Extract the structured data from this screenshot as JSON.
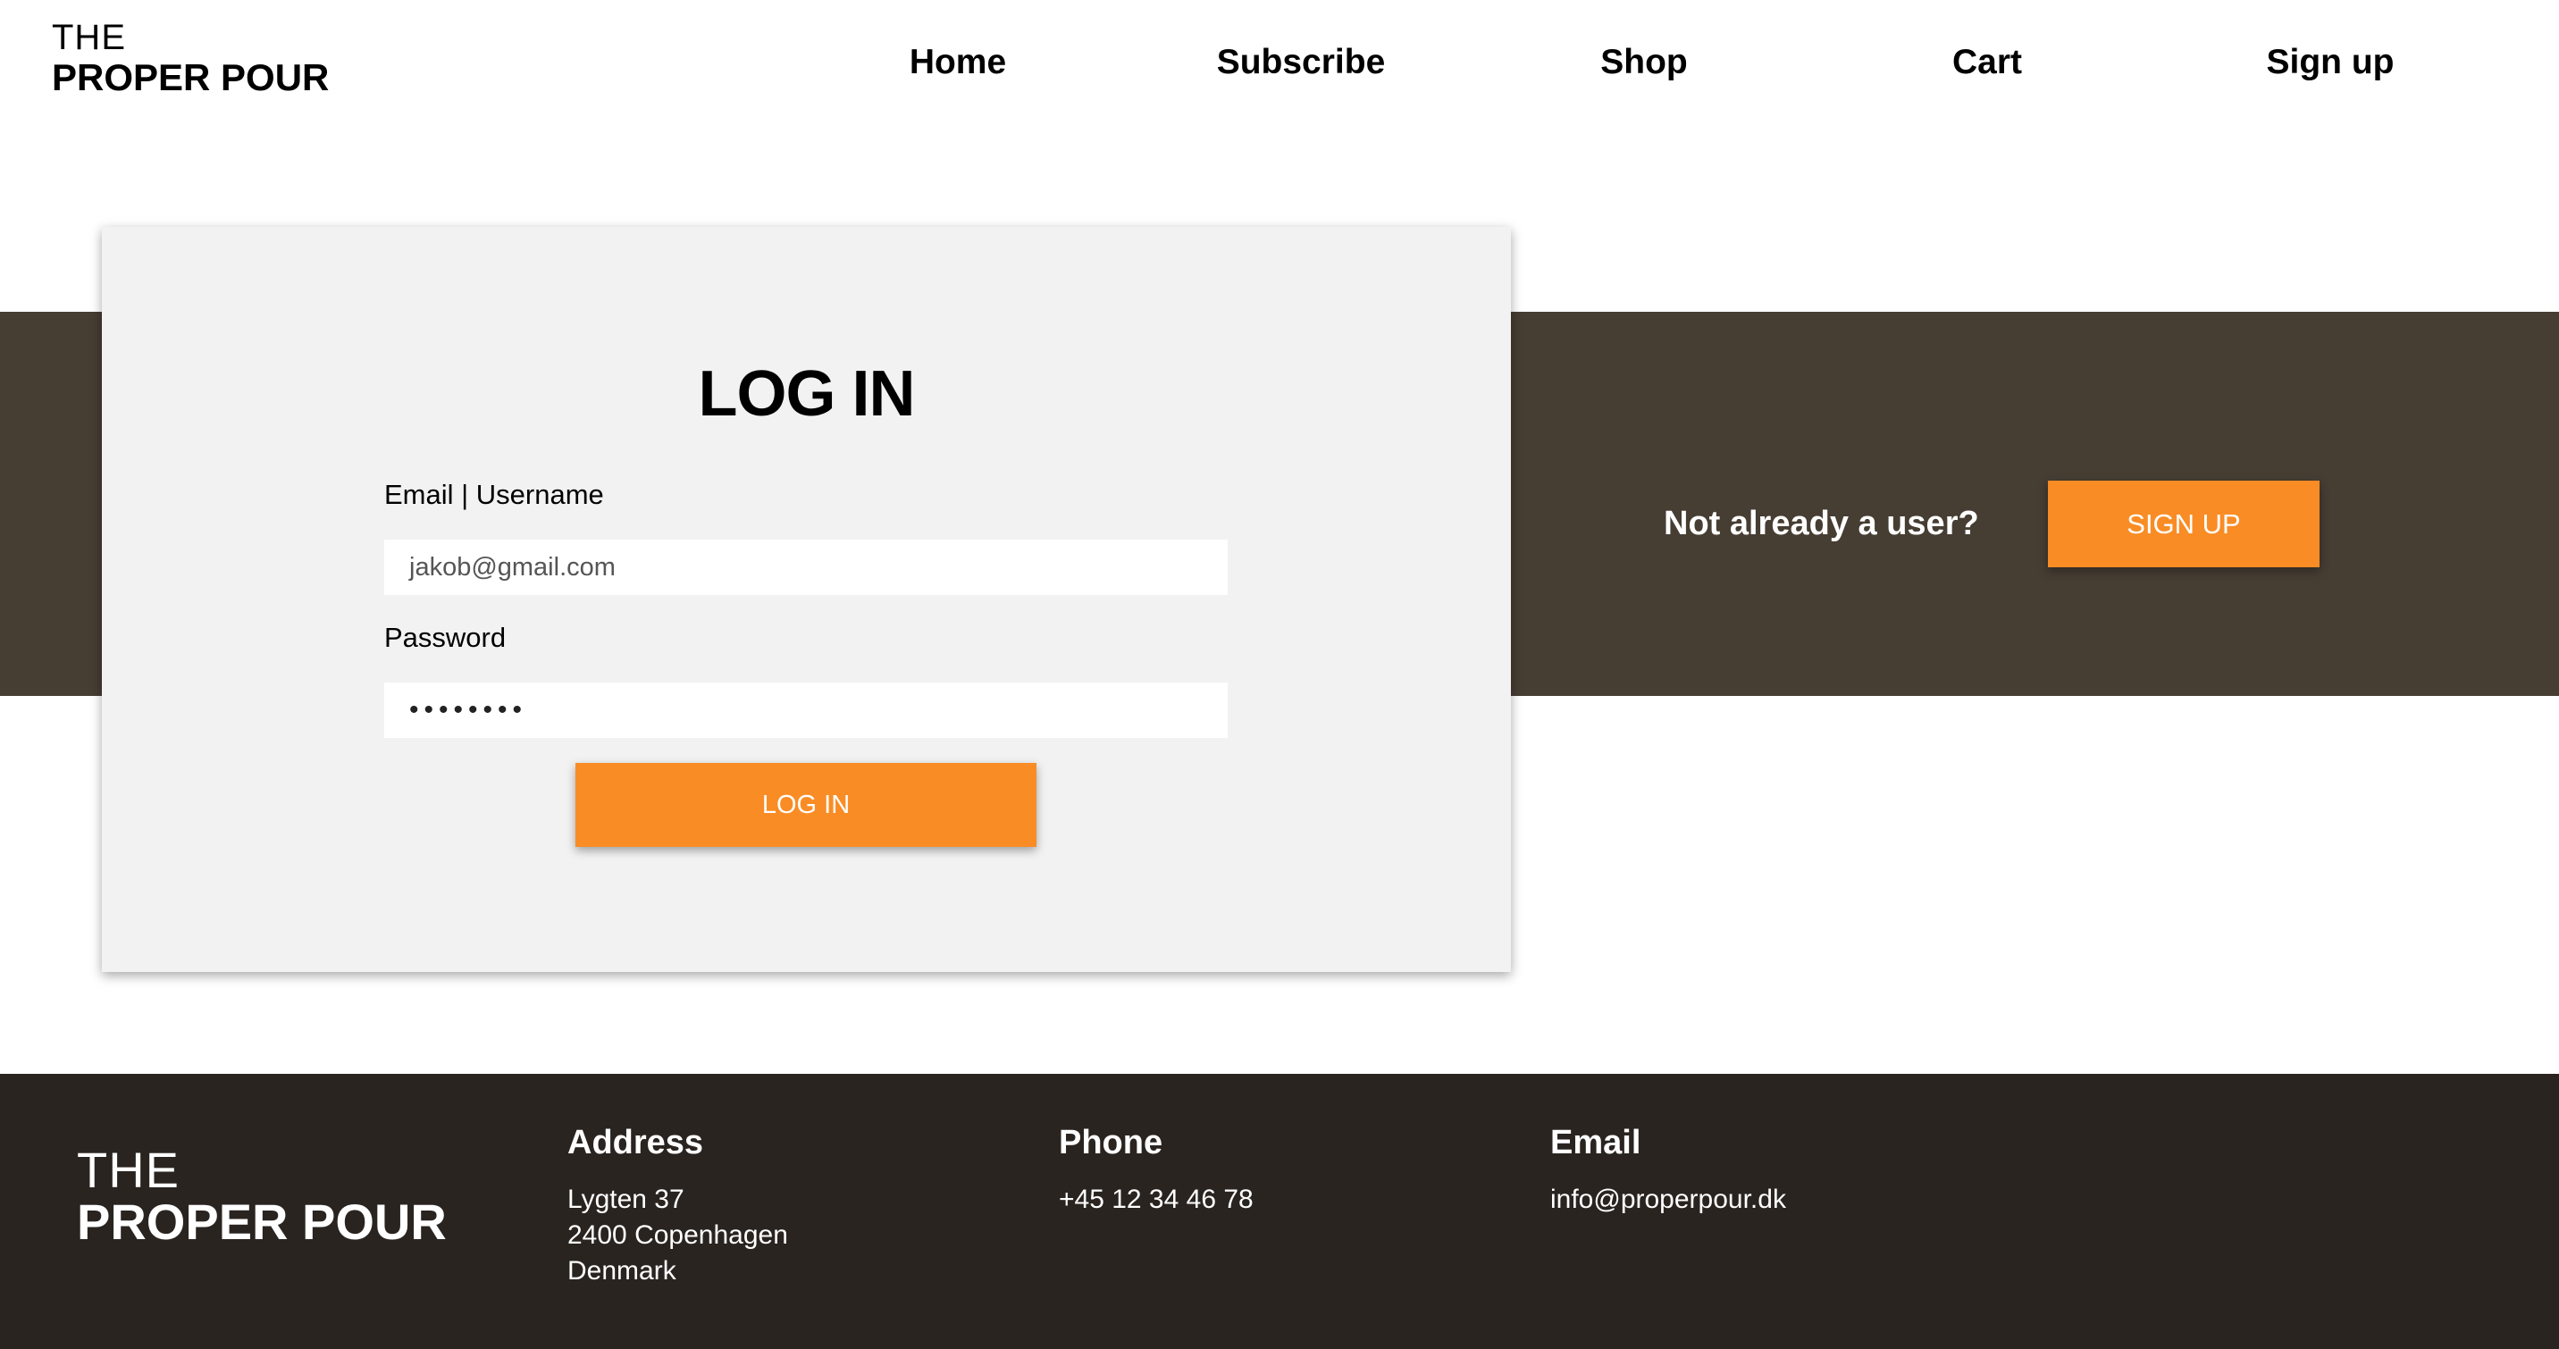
{
  "header": {
    "logo_line1": "THE",
    "logo_line2": "PROPER POUR",
    "nav": [
      "Home",
      "Subscribe",
      "Shop",
      "Cart",
      "Sign up"
    ]
  },
  "login": {
    "title": "LOG IN",
    "email_label": "Email | Username",
    "email_value": "jakob@gmail.com",
    "password_label": "Password",
    "password_value": "••••••••",
    "button": "LOG IN"
  },
  "signup_band": {
    "text": "Not already a user?",
    "button": "SIGN UP"
  },
  "footer": {
    "logo_line1": "THE",
    "logo_line2": "PROPER POUR",
    "address_title": "Address",
    "address_lines": [
      "Lygten 37",
      "2400 Copenhagen",
      "Denmark"
    ],
    "phone_title": "Phone",
    "phone": "+45 12 34 46 78",
    "email_title": "Email",
    "email": "info@properpour.dk"
  },
  "colors": {
    "accent": "#f98c25",
    "band": "#463d33",
    "footer": "#2a2420",
    "card": "#f2f2f2"
  }
}
